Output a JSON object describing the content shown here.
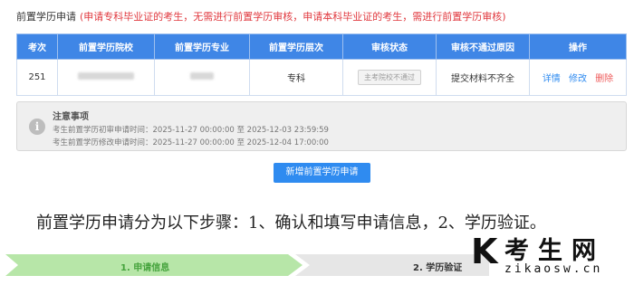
{
  "header": {
    "title": "前置学历申请",
    "note": "(申请专科毕业证的考生，无需进行前置学历审核，申请本科毕业证的考生，需进行前置学历审核)"
  },
  "table": {
    "columns": [
      "考次",
      "前置学历院校",
      "前置学历专业",
      "前置学历层次",
      "审核状态",
      "审核不通过原因",
      "操作"
    ],
    "rows": [
      {
        "exam_no": "251",
        "school": "",
        "major": "",
        "level": "专科",
        "status": "主考院校不通过",
        "reason": "提交材料不齐全",
        "actions": [
          "详情",
          "修改",
          "删除"
        ]
      }
    ]
  },
  "notice": {
    "icon": "info-icon",
    "title": "注意事项",
    "lines": [
      "考生前置学历初审申请时间：2025-11-27 00:00:00 至 2025-12-03 23:59:59",
      "考生前置学历修改申请时间：2025-11-27 00:00:00 至 2025-12-04 17:00:00"
    ]
  },
  "add_button": "新增前置学历申请",
  "caption": "前置学历申请分为以下步骤：1、确认和填写申请信息，2、学历验证。",
  "steps": [
    "1. 申请信息",
    "2. 学历验证"
  ],
  "watermark": {
    "letter": "K",
    "name": "考生网",
    "url": "zikaosw.cn"
  },
  "colors": {
    "accent": "#3f86e6",
    "danger": "#e0383e",
    "step_done": "#b7e6a8",
    "step_pending": "#e6e6e6"
  }
}
